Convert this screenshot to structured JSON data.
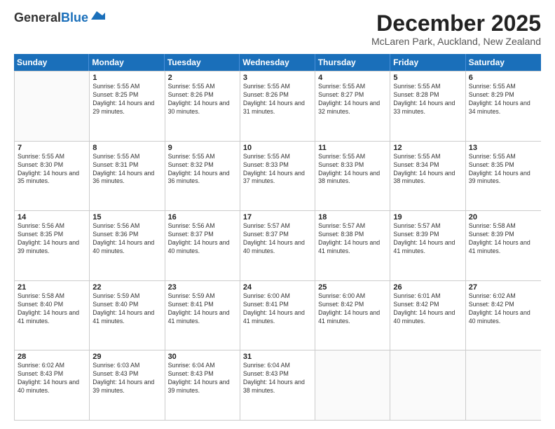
{
  "logo": {
    "general": "General",
    "blue": "Blue"
  },
  "title": "December 2025",
  "location": "McLaren Park, Auckland, New Zealand",
  "days": [
    "Sunday",
    "Monday",
    "Tuesday",
    "Wednesday",
    "Thursday",
    "Friday",
    "Saturday"
  ],
  "weeks": [
    [
      {
        "date": "",
        "sunrise": "",
        "sunset": "",
        "daylight": ""
      },
      {
        "date": "1",
        "sunrise": "Sunrise: 5:55 AM",
        "sunset": "Sunset: 8:25 PM",
        "daylight": "Daylight: 14 hours and 29 minutes."
      },
      {
        "date": "2",
        "sunrise": "Sunrise: 5:55 AM",
        "sunset": "Sunset: 8:26 PM",
        "daylight": "Daylight: 14 hours and 30 minutes."
      },
      {
        "date": "3",
        "sunrise": "Sunrise: 5:55 AM",
        "sunset": "Sunset: 8:26 PM",
        "daylight": "Daylight: 14 hours and 31 minutes."
      },
      {
        "date": "4",
        "sunrise": "Sunrise: 5:55 AM",
        "sunset": "Sunset: 8:27 PM",
        "daylight": "Daylight: 14 hours and 32 minutes."
      },
      {
        "date": "5",
        "sunrise": "Sunrise: 5:55 AM",
        "sunset": "Sunset: 8:28 PM",
        "daylight": "Daylight: 14 hours and 33 minutes."
      },
      {
        "date": "6",
        "sunrise": "Sunrise: 5:55 AM",
        "sunset": "Sunset: 8:29 PM",
        "daylight": "Daylight: 14 hours and 34 minutes."
      }
    ],
    [
      {
        "date": "7",
        "sunrise": "Sunrise: 5:55 AM",
        "sunset": "Sunset: 8:30 PM",
        "daylight": "Daylight: 14 hours and 35 minutes."
      },
      {
        "date": "8",
        "sunrise": "Sunrise: 5:55 AM",
        "sunset": "Sunset: 8:31 PM",
        "daylight": "Daylight: 14 hours and 36 minutes."
      },
      {
        "date": "9",
        "sunrise": "Sunrise: 5:55 AM",
        "sunset": "Sunset: 8:32 PM",
        "daylight": "Daylight: 14 hours and 36 minutes."
      },
      {
        "date": "10",
        "sunrise": "Sunrise: 5:55 AM",
        "sunset": "Sunset: 8:33 PM",
        "daylight": "Daylight: 14 hours and 37 minutes."
      },
      {
        "date": "11",
        "sunrise": "Sunrise: 5:55 AM",
        "sunset": "Sunset: 8:33 PM",
        "daylight": "Daylight: 14 hours and 38 minutes."
      },
      {
        "date": "12",
        "sunrise": "Sunrise: 5:55 AM",
        "sunset": "Sunset: 8:34 PM",
        "daylight": "Daylight: 14 hours and 38 minutes."
      },
      {
        "date": "13",
        "sunrise": "Sunrise: 5:55 AM",
        "sunset": "Sunset: 8:35 PM",
        "daylight": "Daylight: 14 hours and 39 minutes."
      }
    ],
    [
      {
        "date": "14",
        "sunrise": "Sunrise: 5:56 AM",
        "sunset": "Sunset: 8:35 PM",
        "daylight": "Daylight: 14 hours and 39 minutes."
      },
      {
        "date": "15",
        "sunrise": "Sunrise: 5:56 AM",
        "sunset": "Sunset: 8:36 PM",
        "daylight": "Daylight: 14 hours and 40 minutes."
      },
      {
        "date": "16",
        "sunrise": "Sunrise: 5:56 AM",
        "sunset": "Sunset: 8:37 PM",
        "daylight": "Daylight: 14 hours and 40 minutes."
      },
      {
        "date": "17",
        "sunrise": "Sunrise: 5:57 AM",
        "sunset": "Sunset: 8:37 PM",
        "daylight": "Daylight: 14 hours and 40 minutes."
      },
      {
        "date": "18",
        "sunrise": "Sunrise: 5:57 AM",
        "sunset": "Sunset: 8:38 PM",
        "daylight": "Daylight: 14 hours and 41 minutes."
      },
      {
        "date": "19",
        "sunrise": "Sunrise: 5:57 AM",
        "sunset": "Sunset: 8:39 PM",
        "daylight": "Daylight: 14 hours and 41 minutes."
      },
      {
        "date": "20",
        "sunrise": "Sunrise: 5:58 AM",
        "sunset": "Sunset: 8:39 PM",
        "daylight": "Daylight: 14 hours and 41 minutes."
      }
    ],
    [
      {
        "date": "21",
        "sunrise": "Sunrise: 5:58 AM",
        "sunset": "Sunset: 8:40 PM",
        "daylight": "Daylight: 14 hours and 41 minutes."
      },
      {
        "date": "22",
        "sunrise": "Sunrise: 5:59 AM",
        "sunset": "Sunset: 8:40 PM",
        "daylight": "Daylight: 14 hours and 41 minutes."
      },
      {
        "date": "23",
        "sunrise": "Sunrise: 5:59 AM",
        "sunset": "Sunset: 8:41 PM",
        "daylight": "Daylight: 14 hours and 41 minutes."
      },
      {
        "date": "24",
        "sunrise": "Sunrise: 6:00 AM",
        "sunset": "Sunset: 8:41 PM",
        "daylight": "Daylight: 14 hours and 41 minutes."
      },
      {
        "date": "25",
        "sunrise": "Sunrise: 6:00 AM",
        "sunset": "Sunset: 8:42 PM",
        "daylight": "Daylight: 14 hours and 41 minutes."
      },
      {
        "date": "26",
        "sunrise": "Sunrise: 6:01 AM",
        "sunset": "Sunset: 8:42 PM",
        "daylight": "Daylight: 14 hours and 40 minutes."
      },
      {
        "date": "27",
        "sunrise": "Sunrise: 6:02 AM",
        "sunset": "Sunset: 8:42 PM",
        "daylight": "Daylight: 14 hours and 40 minutes."
      }
    ],
    [
      {
        "date": "28",
        "sunrise": "Sunrise: 6:02 AM",
        "sunset": "Sunset: 8:43 PM",
        "daylight": "Daylight: 14 hours and 40 minutes."
      },
      {
        "date": "29",
        "sunrise": "Sunrise: 6:03 AM",
        "sunset": "Sunset: 8:43 PM",
        "daylight": "Daylight: 14 hours and 39 minutes."
      },
      {
        "date": "30",
        "sunrise": "Sunrise: 6:04 AM",
        "sunset": "Sunset: 8:43 PM",
        "daylight": "Daylight: 14 hours and 39 minutes."
      },
      {
        "date": "31",
        "sunrise": "Sunrise: 6:04 AM",
        "sunset": "Sunset: 8:43 PM",
        "daylight": "Daylight: 14 hours and 38 minutes."
      },
      {
        "date": "",
        "sunrise": "",
        "sunset": "",
        "daylight": ""
      },
      {
        "date": "",
        "sunrise": "",
        "sunset": "",
        "daylight": ""
      },
      {
        "date": "",
        "sunrise": "",
        "sunset": "",
        "daylight": ""
      }
    ]
  ]
}
